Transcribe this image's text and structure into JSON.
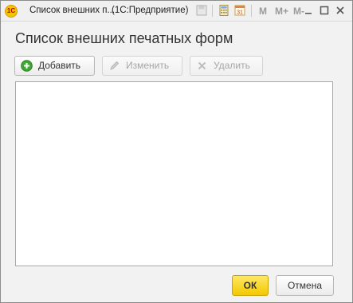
{
  "window": {
    "app_icon_text": "1С",
    "title": "Список внешних п...",
    "app_name": "(1С:Предприятие)",
    "toolbar_m": [
      "M",
      "M+",
      "M-"
    ]
  },
  "form": {
    "title": "Список внешних печатных форм"
  },
  "toolbar": {
    "add_label": "Добавить",
    "edit_label": "Изменить",
    "delete_label": "Удалить"
  },
  "footer": {
    "ok_label": "ОК",
    "cancel_label": "Отмена"
  },
  "colors": {
    "ok_button": "#f4c800",
    "add_icon": "#3fa833"
  },
  "icons": [
    "app-icon",
    "save-icon",
    "calculator-icon",
    "calendar-icon",
    "add-icon",
    "edit-icon",
    "delete-icon",
    "minimize-icon",
    "maximize-icon",
    "close-icon"
  ]
}
